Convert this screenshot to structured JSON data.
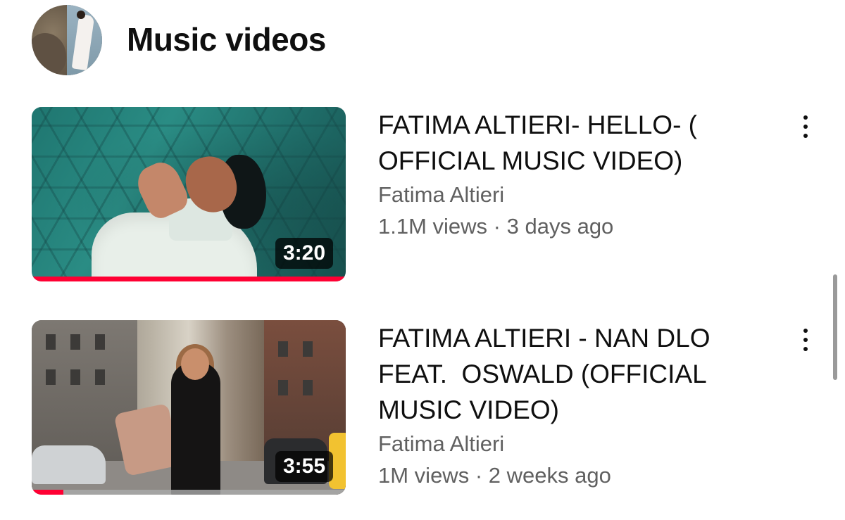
{
  "section": {
    "title": "Music videos",
    "avatar_icon": "channel-avatar"
  },
  "videos": [
    {
      "title": "FATIMA ALTIERI- HELLO- ( OFFICIAL MUSIC VIDEO)",
      "channel": "Fatima Altieri",
      "views": "1.1M views",
      "separator": "·",
      "age": "3 days ago",
      "duration": "3:20",
      "watched_fraction": 1.0
    },
    {
      "title": "FATIMA ALTIERI - NAN DLO FEAT.  OSWALD (OFFICIAL MUSIC VIDEO)",
      "channel": "Fatima Altieri",
      "views": "1M views",
      "separator": "·",
      "age": "2 weeks ago",
      "duration": "3:55",
      "watched_fraction": 0.1
    }
  ],
  "icons": {
    "more": "more-vert-icon"
  },
  "colors": {
    "progress": "#ff0033",
    "secondary_text": "#606060",
    "primary_text": "#0f0f0f"
  }
}
